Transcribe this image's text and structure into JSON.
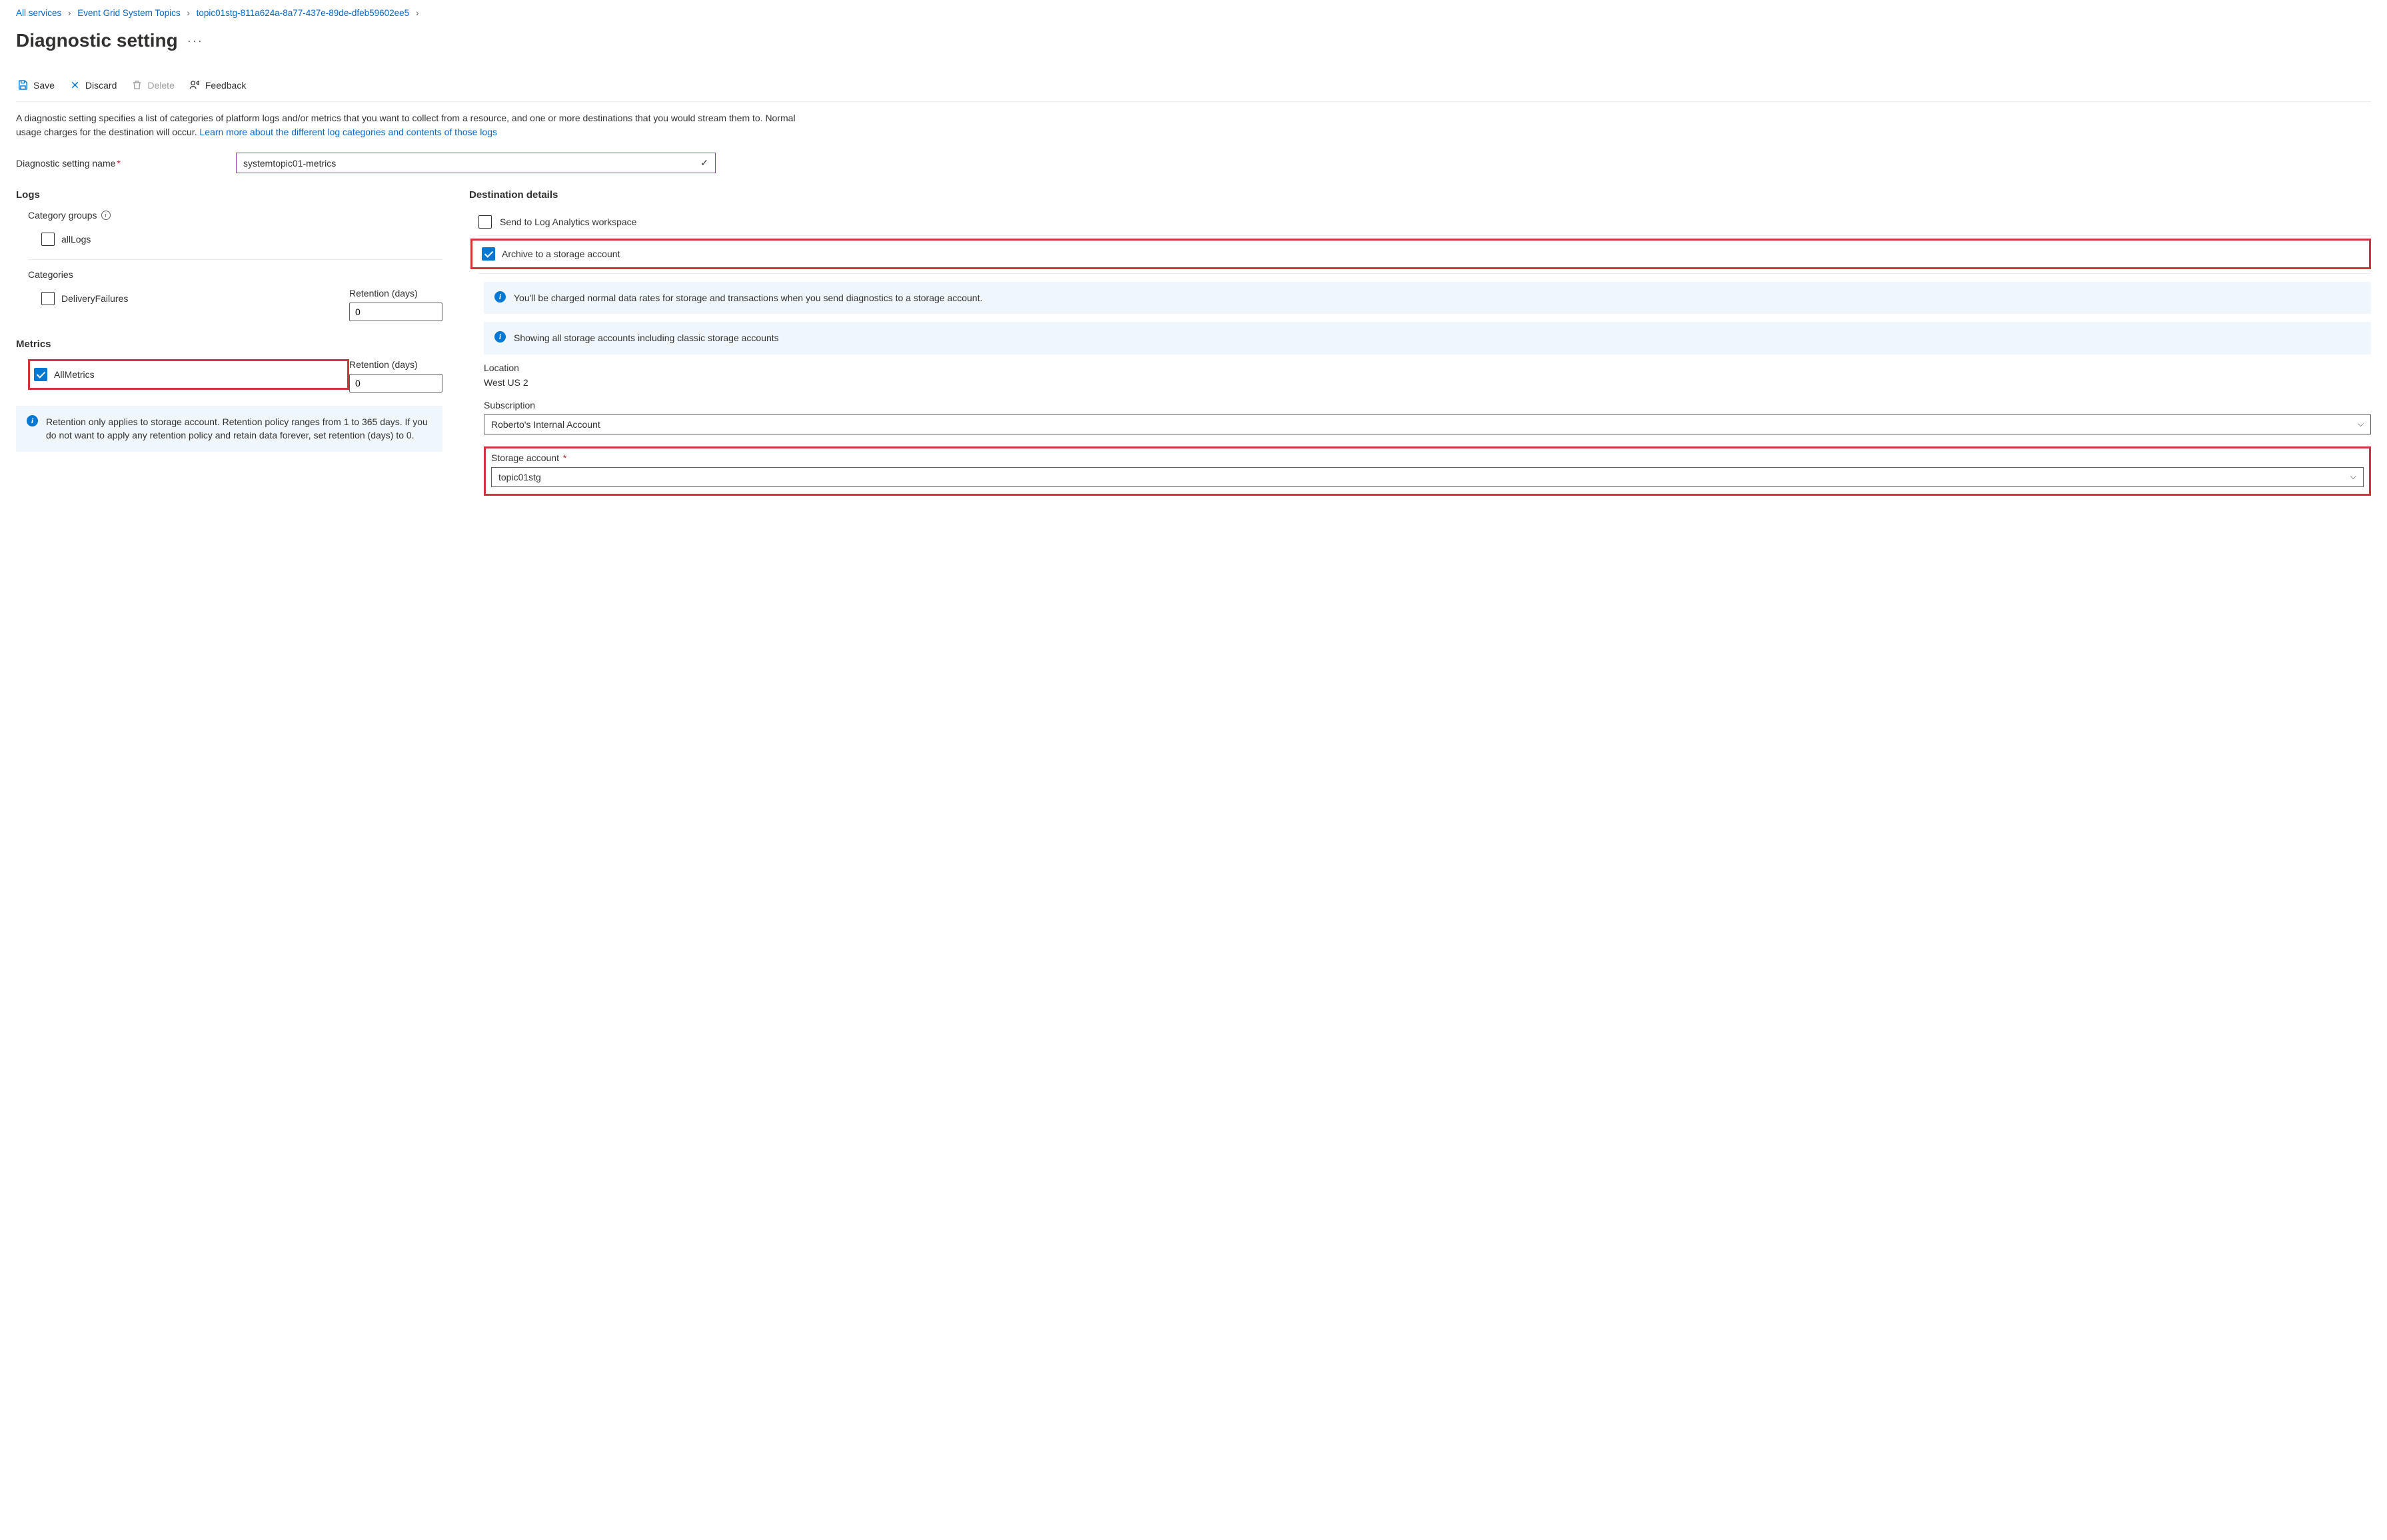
{
  "breadcrumb": {
    "items": [
      "All services",
      "Event Grid System Topics",
      "topic01stg-811a624a-8a77-437e-89de-dfeb59602ee5"
    ]
  },
  "title": "Diagnostic setting",
  "toolbar": {
    "save": "Save",
    "discard": "Discard",
    "delete": "Delete",
    "feedback": "Feedback"
  },
  "description_text": "A diagnostic setting specifies a list of categories of platform logs and/or metrics that you want to collect from a resource, and one or more destinations that you would stream them to. Normal usage charges for the destination will occur. ",
  "description_link": "Learn more about the different log categories and contents of those logs",
  "name_label": "Diagnostic setting name",
  "name_value": "systemtopic01-metrics",
  "logs": {
    "heading": "Logs",
    "category_groups_label": "Category groups",
    "all_logs": "allLogs",
    "categories_label": "Categories",
    "delivery_failures": "DeliveryFailures",
    "retention_label": "Retention (days)",
    "retention_delivery": "0"
  },
  "metrics": {
    "heading": "Metrics",
    "all_metrics": "AllMetrics",
    "retention_label": "Retention (days)",
    "retention_all": "0"
  },
  "retention_info": "Retention only applies to storage account. Retention policy ranges from 1 to 365 days. If you do not want to apply any retention policy and retain data forever, set retention (days) to 0.",
  "destination": {
    "heading": "Destination details",
    "law": "Send to Log Analytics workspace",
    "archive": "Archive to a storage account",
    "charge_info": "You'll be charged normal data rates for storage and transactions when you send diagnostics to a storage account.",
    "showing_info": "Showing all storage accounts including classic storage accounts",
    "location_label": "Location",
    "location_value": "West US 2",
    "subscription_label": "Subscription",
    "subscription_value": "Roberto's Internal Account",
    "storage_label": "Storage account",
    "storage_value": "topic01stg"
  }
}
